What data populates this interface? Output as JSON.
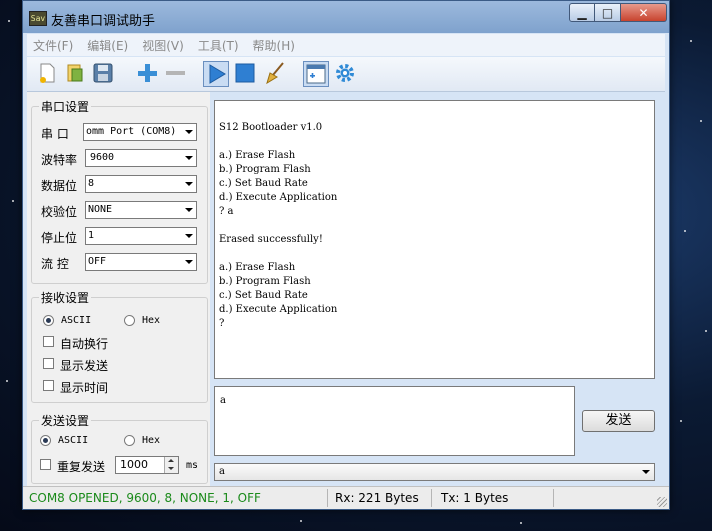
{
  "window": {
    "title": "友善串口调试助手",
    "app_icon_text": "Sav",
    "min_glyph": "▁",
    "max_glyph": "□",
    "close_glyph": "✕"
  },
  "menu": [
    "文件(F)",
    "编辑(E)",
    "视图(V)",
    "工具(T)",
    "帮助(H)"
  ],
  "toolbar": {
    "buttons": [
      {
        "name": "new-icon"
      },
      {
        "name": "open-icon"
      },
      {
        "name": "save-icon"
      },
      {
        "name": "add-icon"
      },
      {
        "name": "remove-icon"
      },
      {
        "name": "start-icon",
        "pressed": true
      },
      {
        "name": "stop-icon"
      },
      {
        "name": "clear-icon"
      },
      {
        "name": "new-window-icon",
        "pressed": true
      },
      {
        "name": "settings-icon"
      }
    ]
  },
  "serial": {
    "title": "串口设置",
    "port_label": "串  口",
    "port_value": "omm Port (COM8)",
    "baud_label": "波特率",
    "baud_value": "9600",
    "data_bits_label": "数据位",
    "data_bits_value": "8",
    "parity_label": "校验位",
    "parity_value": "NONE",
    "stop_bits_label": "停止位",
    "stop_bits_value": "1",
    "flow_label": "流  控",
    "flow_value": "OFF"
  },
  "receive": {
    "title": "接收设置",
    "ascii_label": "ASCII",
    "hex_label": "Hex",
    "mode": "ASCII",
    "auto_newline_label": "自动换行",
    "show_send_label": "显示发送",
    "show_time_label": "显示时间"
  },
  "send_settings": {
    "title": "发送设置",
    "ascii_label": "ASCII",
    "hex_label": "Hex",
    "mode": "ASCII",
    "repeat_label": "重复发送",
    "repeat_interval": "1000",
    "repeat_unit": "ms"
  },
  "receive_text": "S12 Bootloader v1.0\n\na.) Erase Flash\nb.) Program Flash\nc.) Set Baud Rate\nd.) Execute Application\n? a\n\nErased successfully!\n\na.) Erase Flash\nb.) Program Flash\nc.) Set Baud Rate\nd.) Execute Application\n?",
  "send_text": "a",
  "send_button": "发送",
  "history_value": "a",
  "status": {
    "connection": "COM8 OPENED, 9600, 8, NONE, 1, OFF",
    "rx": "Rx: 221 Bytes",
    "tx": "Tx: 1 Bytes",
    "connection_color": "#1a8a1a"
  }
}
